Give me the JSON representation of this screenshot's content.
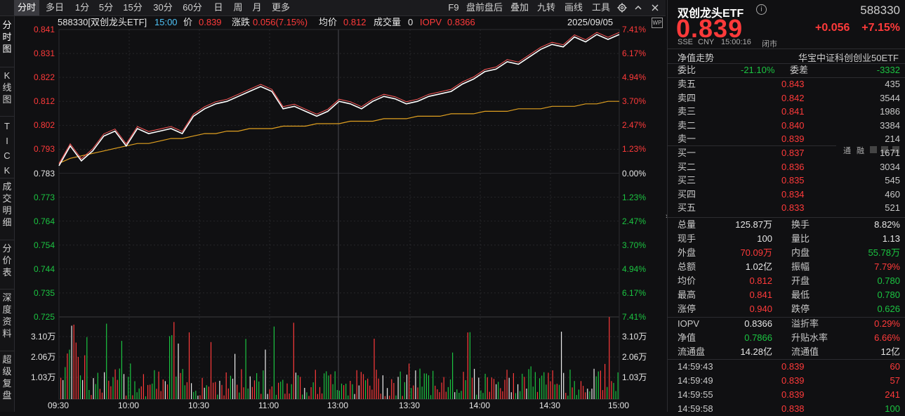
{
  "toolbar": {
    "tabs": [
      "分时",
      "多日",
      "1分",
      "5分",
      "15分",
      "30分",
      "60分",
      "日",
      "周",
      "月",
      "更多"
    ],
    "right_tabs": [
      "F9",
      "盘前盘后",
      "叠加",
      "九转",
      "画线",
      "工具"
    ]
  },
  "left_tabs": [
    "分时图",
    "K线图",
    "TICK",
    "成交明细",
    "分价表",
    "深度资料",
    "超级复盘"
  ],
  "chart_info": {
    "code_name": "588330[双创龙头ETF]",
    "time": "15:00",
    "price_label": "价",
    "price": "0.839",
    "change_label": "涨跌",
    "change": "0.056(7.15%)",
    "avg_label": "均价",
    "avg": "0.812",
    "volume_label": "成交量",
    "volume": "0",
    "iopv_label": "IOPV",
    "iopv": "0.8366",
    "date": "2025/09/05"
  },
  "chart_data": {
    "type": "line",
    "series": [
      {
        "values": [
          0.786,
          0.794,
          0.788,
          0.792,
          0.798,
          0.8,
          0.794,
          0.801,
          0.799,
          0.8,
          0.801,
          0.799,
          0.806,
          0.809,
          0.811,
          0.812,
          0.814,
          0.816,
          0.818,
          0.816,
          0.809,
          0.81,
          0.808,
          0.806,
          0.808,
          0.812,
          0.811,
          0.809,
          0.812,
          0.814,
          0.813,
          0.811,
          0.812,
          0.814,
          0.815,
          0.816,
          0.819,
          0.821,
          0.824,
          0.825,
          0.828,
          0.827,
          0.83,
          0.833,
          0.835,
          0.834,
          0.838,
          0.836,
          0.839,
          0.837,
          0.839
        ]
      },
      {
        "values": [
          0.787,
          0.789,
          0.79,
          0.791,
          0.792,
          0.793,
          0.794,
          0.795,
          0.795,
          0.796,
          0.797,
          0.797,
          0.798,
          0.799,
          0.799,
          0.8,
          0.8,
          0.801,
          0.801,
          0.801,
          0.802,
          0.802,
          0.802,
          0.803,
          0.803,
          0.803,
          0.804,
          0.804,
          0.804,
          0.805,
          0.805,
          0.805,
          0.806,
          0.806,
          0.806,
          0.807,
          0.807,
          0.807,
          0.808,
          0.808,
          0.808,
          0.809,
          0.809,
          0.809,
          0.81,
          0.81,
          0.81,
          0.811,
          0.811,
          0.812,
          0.812
        ]
      }
    ],
    "y_price_ticks": [
      "0.841",
      "0.831",
      "0.822",
      "0.812",
      "0.802",
      "0.793",
      "0.783",
      "0.773",
      "0.764",
      "0.754",
      "0.744",
      "0.735",
      "0.725"
    ],
    "y_pct_ticks": [
      "7.41%",
      "6.17%",
      "4.94%",
      "3.70%",
      "2.47%",
      "1.23%",
      "0.00%",
      "1.23%",
      "2.47%",
      "3.70%",
      "4.94%",
      "6.17%",
      "7.41%"
    ],
    "vol_ticks": [
      "3.10万",
      "2.06万",
      "1.03万"
    ],
    "x_ticks": [
      "09:30",
      "10:00",
      "10:30",
      "11:00",
      "13:00",
      "13:30",
      "14:00",
      "14:30",
      "15:00"
    ],
    "ylim": [
      0.725,
      0.841
    ],
    "base": 0.783
  },
  "quote": {
    "name": "双创龙头ETF",
    "code": "588330",
    "price": "0.839",
    "change": "+0.056",
    "change_pct": "+7.15%",
    "exchange": "SSE",
    "currency": "CNY",
    "time": "15:00:16",
    "status": "闭市",
    "nav_trend_label": "净值走势",
    "index_name": "华宝中证科创创业50ETF"
  },
  "order_book": {
    "weibi_label": "委比",
    "weibi": "-21.10%",
    "weicha_label": "委差",
    "weicha": "-3332",
    "sells": [
      {
        "label": "卖五",
        "price": "0.843",
        "vol": "435"
      },
      {
        "label": "卖四",
        "price": "0.842",
        "vol": "3544"
      },
      {
        "label": "卖三",
        "price": "0.841",
        "vol": "1986"
      },
      {
        "label": "卖二",
        "price": "0.840",
        "vol": "3384"
      },
      {
        "label": "卖一",
        "price": "0.839",
        "vol": "214"
      }
    ],
    "buys": [
      {
        "label": "买一",
        "price": "0.837",
        "vol": "1671"
      },
      {
        "label": "买二",
        "price": "0.836",
        "vol": "3034"
      },
      {
        "label": "买三",
        "price": "0.835",
        "vol": "545"
      },
      {
        "label": "买四",
        "price": "0.834",
        "vol": "460"
      },
      {
        "label": "买五",
        "price": "0.833",
        "vol": "521"
      }
    ],
    "tags": [
      "通",
      "融"
    ]
  },
  "stats": [
    [
      "总量",
      "125.87万",
      "换手",
      "8.82%"
    ],
    [
      "现手",
      "100",
      "量比",
      "1.13"
    ],
    [
      "外盘",
      "70.09万",
      "内盘",
      "55.78万"
    ],
    [
      "总额",
      "1.02亿",
      "振幅",
      "7.79%"
    ],
    [
      "均价",
      "0.812",
      "开盘",
      "0.780"
    ],
    [
      "最高",
      "0.841",
      "最低",
      "0.780"
    ],
    [
      "涨停",
      "0.940",
      "跌停",
      "0.626"
    ]
  ],
  "stats2": [
    [
      "IOPV",
      "0.8366",
      "溢折率",
      "0.29%"
    ],
    [
      "净值",
      "0.7866",
      "升贴水率",
      "6.66%"
    ],
    [
      "流通盘",
      "14.28亿",
      "流通值",
      "12亿"
    ]
  ],
  "ticks": [
    {
      "time": "14:59:43",
      "price": "0.839",
      "vol": "60"
    },
    {
      "time": "14:59:49",
      "price": "0.839",
      "vol": "57"
    },
    {
      "time": "14:59:55",
      "price": "0.839",
      "vol": "241"
    },
    {
      "time": "14:59:58",
      "price": "0.838",
      "vol": "100"
    }
  ],
  "colors": {
    "up": "#ff3a3a",
    "down": "#1bc441",
    "price_line": "#ffffff",
    "avg_line": "#e0a020",
    "bg": "#101012"
  }
}
